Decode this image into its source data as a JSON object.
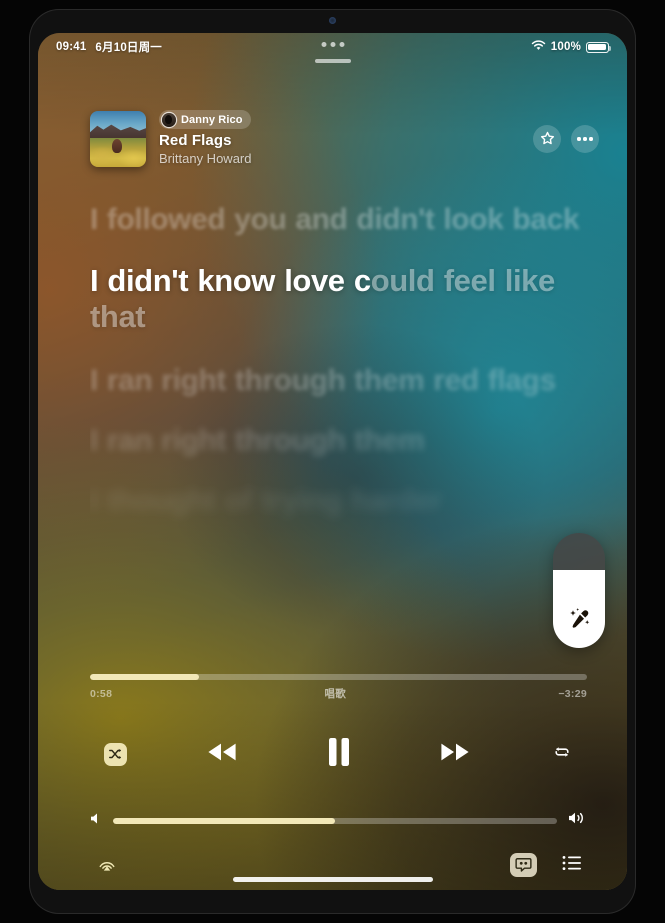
{
  "status_bar": {
    "time": "09:41",
    "date": "6月10日周一",
    "wifi_icon": "wifi-icon",
    "battery_percent": "100%",
    "battery_icon": "battery-full-icon"
  },
  "window_chrome": {
    "multitask_icon": "multitask-dots-icon",
    "grabber": "window-grabber"
  },
  "now_playing": {
    "artwork_alt": "album-artwork",
    "badge_name": "Danny Rico",
    "badge_avatar": "user-avatar",
    "title": "Red Flags",
    "artist": "Brittany Howard",
    "favorite_icon": "star-icon",
    "more_icon": "ellipsis-icon"
  },
  "lyrics": {
    "lines": [
      {
        "text": "I followed you and didn't look back",
        "state": "past"
      },
      {
        "text": "I didn't know love could feel like that",
        "state": "active",
        "sung": "I didn't know love c",
        "unsung": "ould feel like that"
      },
      {
        "text": "I ran right through them red flags",
        "state": "next"
      },
      {
        "text": "I ran right through them",
        "state": "next2"
      },
      {
        "text": "I thought of trying harder",
        "state": "next3"
      }
    ]
  },
  "sing_slider": {
    "icon": "microphone-sparkles-icon",
    "fill_percent": 68,
    "label": "Sing"
  },
  "playback": {
    "elapsed": "0:58",
    "remaining": "−3:29",
    "center_label": "唱歌",
    "progress_percent": 22,
    "shuffle_icon": "shuffle-icon",
    "shuffle_active": true,
    "rewind_icon": "rewind-icon",
    "pause_icon": "pause-icon",
    "forward_icon": "fast-forward-icon",
    "repeat_icon": "repeat-icon",
    "repeat_active": false
  },
  "volume": {
    "level_percent": 50,
    "min_icon": "speaker-min-icon",
    "max_icon": "speaker-max-icon"
  },
  "bottom_bar": {
    "airplay_icon": "airplay-icon",
    "lyrics_icon": "lyrics-quote-icon",
    "lyrics_active": true,
    "queue_icon": "queue-list-icon"
  },
  "colors": {
    "accent": "#f2e8b8",
    "teal": "#168496",
    "rust": "#965628",
    "olive": "#927e16",
    "text_primary": "#ffffff"
  }
}
